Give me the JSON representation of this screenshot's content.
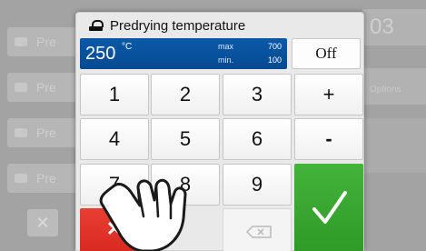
{
  "background": {
    "row_label": "Pre",
    "right_value": "03",
    "right_caption": "Options",
    "close_glyph": "✕"
  },
  "dialog": {
    "title": "Predrying temperature",
    "title_icon": "furnace-icon"
  },
  "display": {
    "value": "250",
    "unit": "°C",
    "max_label": "max",
    "max_value": "700",
    "min_label": "min.",
    "min_value": "100"
  },
  "off_label": "Off",
  "keys": {
    "k1": "1",
    "k2": "2",
    "k3": "3",
    "plus": "+",
    "k4": "4",
    "k5": "5",
    "k6": "6",
    "minus": "-",
    "k7": "7",
    "k8": "8",
    "k9": "9"
  },
  "cancel_glyph": "✕",
  "colors": {
    "display_blue": "#0b59a8",
    "cancel_red": "#e2342a",
    "confirm_green": "#3aab31"
  }
}
